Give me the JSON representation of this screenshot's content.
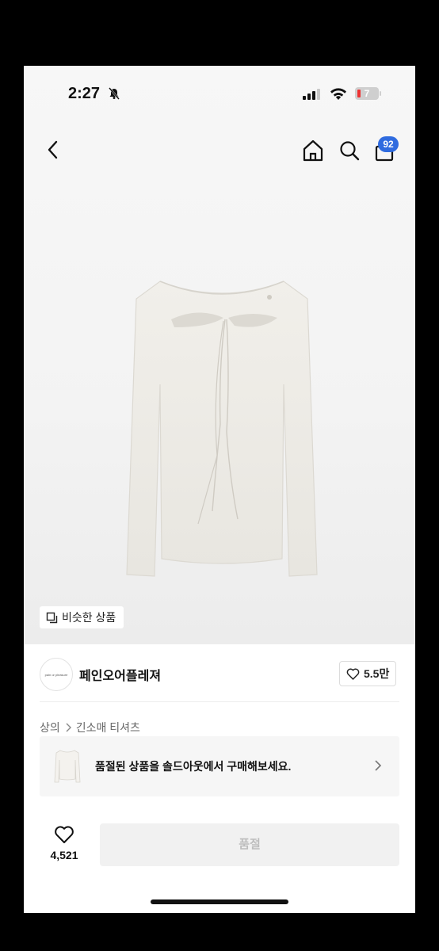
{
  "status_bar": {
    "time": "2:27",
    "battery": "7"
  },
  "nav": {
    "cart_count": "92"
  },
  "hero": {
    "similar_label": "비슷한 상품"
  },
  "brand": {
    "name": "페인오어플레져",
    "logo_text": "pain or pleasure",
    "likes": "5.5만"
  },
  "breadcrumb": {
    "category": "상의",
    "subcategory": "긴소매 티셔츠"
  },
  "soldout_banner": {
    "text": "품절된 상품을 솔드아웃에서 구매해보세요."
  },
  "bottom_bar": {
    "wish_count": "4,521",
    "buy_label": "품절"
  },
  "colors": {
    "badge": "#2f6bdf",
    "battery_low": "#e33333",
    "disabled_bg": "#f1f1f1",
    "disabled_text": "#bdbdbd"
  }
}
